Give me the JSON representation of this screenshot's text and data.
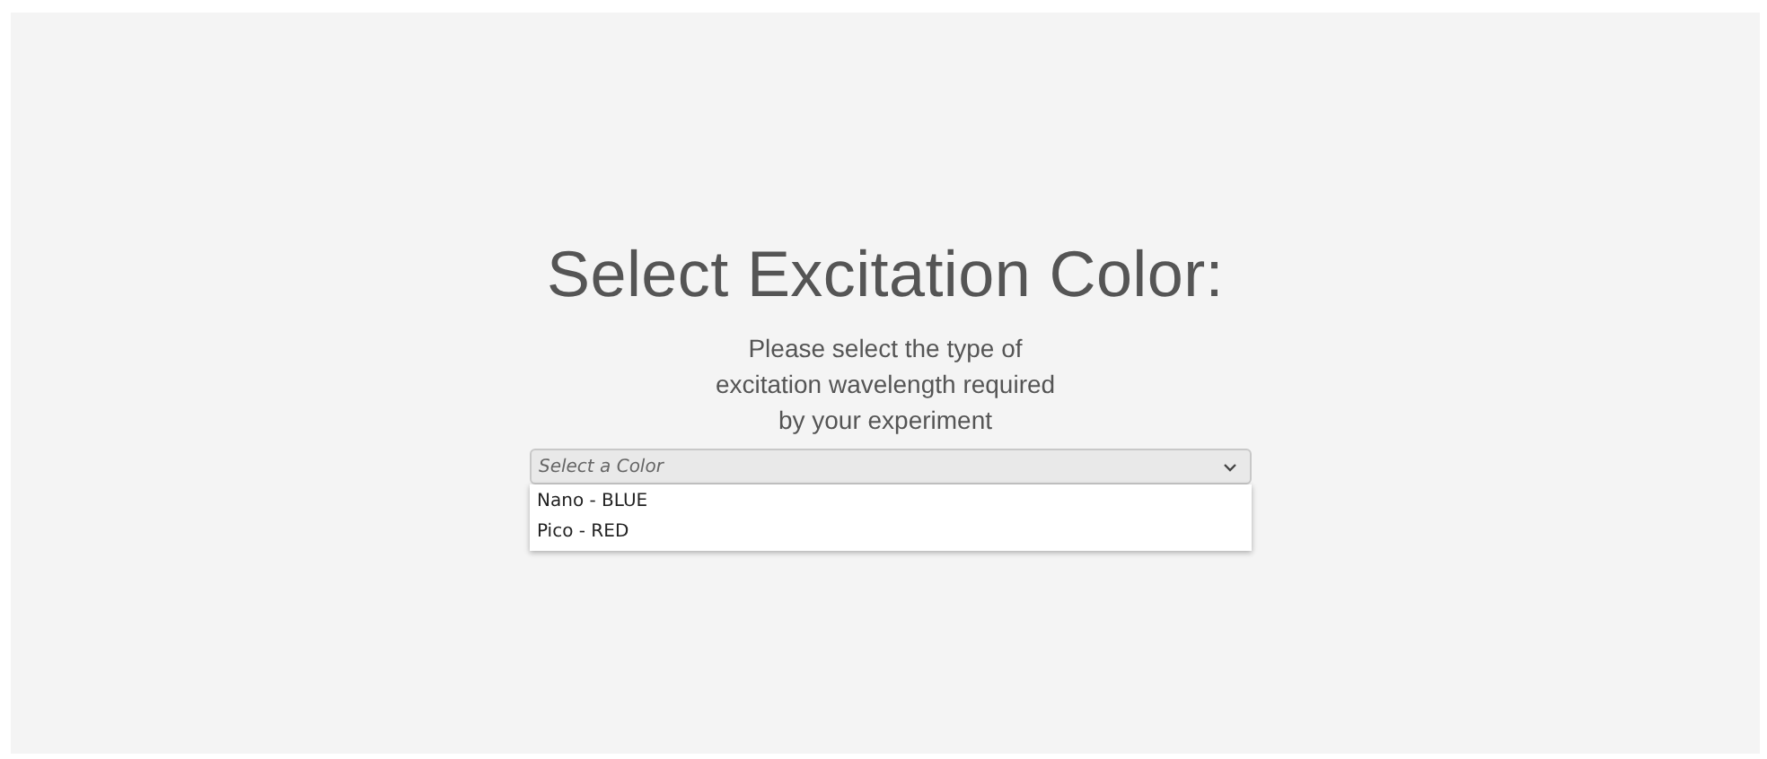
{
  "title": "Select Excitation Color:",
  "description": "Please select the type of\nexcitation wavelength required\nby your experiment",
  "dropdown": {
    "placeholder": "Select a Color",
    "expanded": true,
    "options": [
      {
        "label": "Nano - BLUE",
        "selected": false
      },
      {
        "label": "Pico - RED",
        "selected": false
      }
    ]
  }
}
